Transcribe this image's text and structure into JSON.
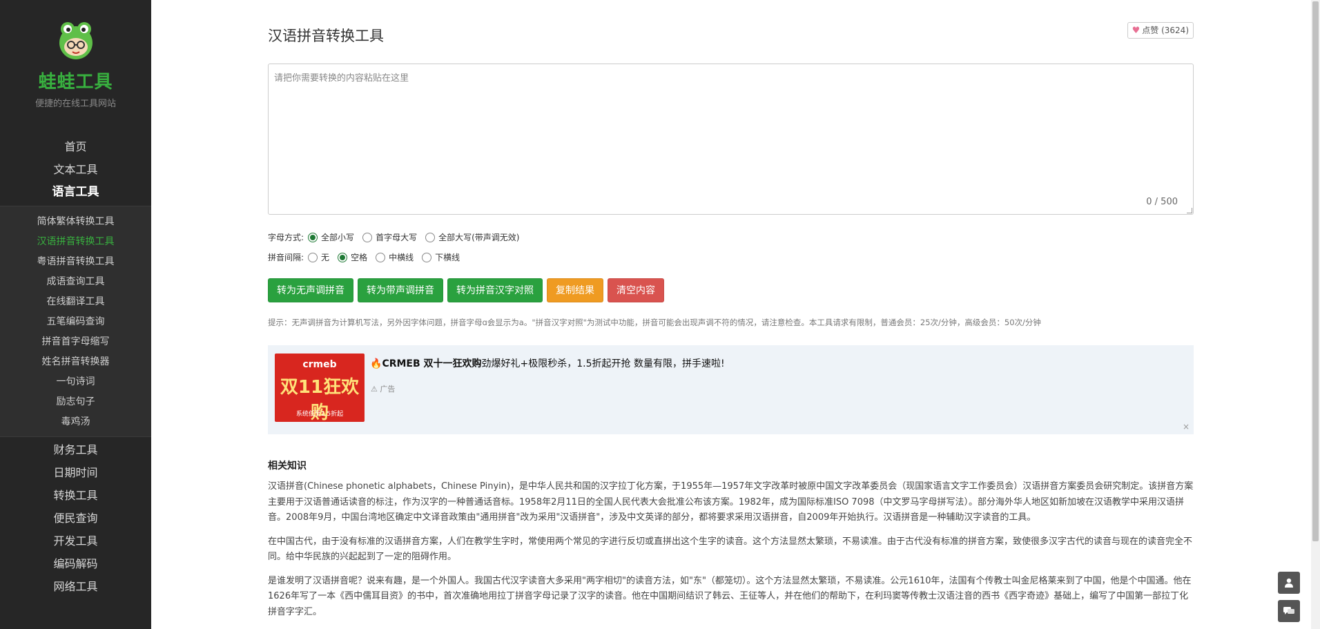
{
  "brand": {
    "title": "蛙蛙工具",
    "subtitle": "便捷的在线工具网站"
  },
  "nav": {
    "top_items": [
      "首页",
      "文本工具"
    ],
    "active_section": "语言工具",
    "sub_items": [
      "简体繁体转换工具",
      "汉语拼音转换工具",
      "粤语拼音转换工具",
      "成语查询工具",
      "在线翻译工具",
      "五笔编码查询",
      "拼音首字母缩写",
      "姓名拼音转换器",
      "一句诗词",
      "励志句子",
      "毒鸡汤"
    ],
    "current_sub": "汉语拼音转换工具",
    "bottom_items": [
      "财务工具",
      "日期时间",
      "转换工具",
      "便民查询",
      "开发工具",
      "编码解码",
      "网络工具"
    ]
  },
  "page": {
    "title": "汉语拼音转换工具",
    "like_label": "点赞 (3624)"
  },
  "input": {
    "placeholder": "请把你需要转换的内容粘贴在这里",
    "value": "",
    "counter": "0 / 500"
  },
  "options": {
    "case_label": "字母方式:",
    "case_options": [
      "全部小写",
      "首字母大写",
      "全部大写(带声调无效)"
    ],
    "case_selected": "全部小写",
    "sep_label": "拼音间隔:",
    "sep_options": [
      "无",
      "空格",
      "中横线",
      "下横线"
    ],
    "sep_selected": "空格"
  },
  "buttons": {
    "no_tone": "转为无声调拼音",
    "with_tone": "转为带声调拼音",
    "compare": "转为拼音汉字对照",
    "copy": "复制结果",
    "clear": "清空内容"
  },
  "tip": "提示：无声调拼音为计算机写法，另外因字体问题，拼音字母ɑ会显示为a。\"拼音汉字对照\"为测试中功能，拼音可能会出现声调不符的情况，请注意检查。本工具请求有限制，普通会员：25次/分钟，高级会员：50次/分钟",
  "ad": {
    "img_top": "crmeb",
    "img_big": "双11狂欢购",
    "img_small": "系统低至1.5折起",
    "title_bold": "CRMEB 双十一狂欢购",
    "title_rest": "劲爆好礼+极限秒杀，1.5折起开抢 数量有限，拼手速啦!",
    "label": "广告",
    "close": "×"
  },
  "knowledge": {
    "title": "相关知识",
    "paragraphs": [
      "汉语拼音(Chinese phonetic alphabets，Chinese Pinyin)，是中华人民共和国的汉字拉丁化方案，于1955年—1957年文字改革时被原中国文字改革委员会（现国家语言文字工作委员会）汉语拼音方案委员会研究制定。该拼音方案主要用于汉语普通话读音的标注，作为汉字的一种普通话音标。1958年2月11日的全国人民代表大会批准公布该方案。1982年，成为国际标准ISO 7098（中文罗马字母拼写法）。部分海外华人地区如新加坡在汉语教学中采用汉语拼音。2008年9月，中国台湾地区确定中文译音政策由\"通用拼音\"改为采用\"汉语拼音\"，涉及中文英译的部分，都将要求采用汉语拼音，自2009年开始执行。汉语拼音是一种辅助汉字读音的工具。",
      "在中国古代，由于没有标准的汉语拼音方案，人们在教学生字时，常使用两个常见的字进行反切或直拼出这个生字的读音。这个方法显然太繁琐，不易读准。由于古代没有标准的拼音方案，致使很多汉字古代的读音与现在的读音完全不同。给中华民族的兴起起到了一定的阻碍作用。",
      "是谁发明了汉语拼音呢？说来有趣，是一个外国人。我国古代汉字读音大多采用\"两字相切\"的读音方法，如\"东\"（都笼切）。这个方法显然太繁琐，不易读准。公元1610年，法国有个传教士叫金尼格莱来到了中国，他是个中国通。他在1626年写了一本《西中儒耳目资》的书中，首次准确地用拉丁拼音字母记录了汉字的读音。他在中国期间结识了韩云、王征等人，并在他们的帮助下，在利玛窦等传教士汉语注音的西书《西字奇迹》基础上，编写了中国第一部拉丁化拼音字字汇。"
    ]
  },
  "colors": {
    "sidebar_bg": "#262626",
    "brand_green": "#38b03f",
    "btn_green": "#2aa13f",
    "btn_orange": "#ef9b22",
    "btn_red": "#d9534f"
  },
  "icons": {
    "logo": "frog-logo-icon",
    "heart": "heart-icon",
    "user": "user-icon",
    "chat": "chat-icon"
  }
}
